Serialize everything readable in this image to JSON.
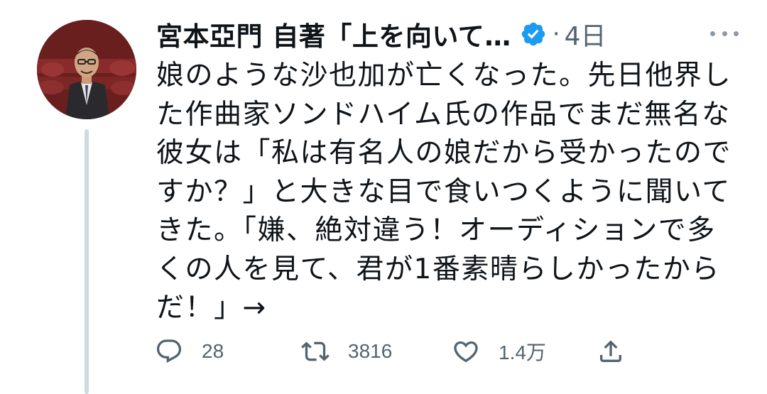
{
  "tweet": {
    "display_name": "宮本亞門 自著「上を向いて…",
    "separator": "·",
    "time": "4日",
    "text": "娘のような沙也加が亡くなった。先日他界した作曲家ソンドハイム氏の作品でまだ無名な彼女は「私は有名人の娘だから受かったのですか？」と大きな目で食いつくように聞いてきた。「嫌、絶対違う！オーディションで多くの人を見て、君が1番素晴らしかったからだ！」→",
    "verified": true
  },
  "actions": {
    "reply_count": "28",
    "retweet_count": "3816",
    "like_count": "1.4万"
  },
  "colors": {
    "text_primary": "#0f1419",
    "text_secondary": "#536471",
    "verified_blue": "#1d9bf0",
    "thread_line": "#cfd9de"
  },
  "icons": [
    "avatar",
    "verified-badge-icon",
    "more-options-icon",
    "reply-icon",
    "retweet-icon",
    "like-icon",
    "share-icon"
  ]
}
